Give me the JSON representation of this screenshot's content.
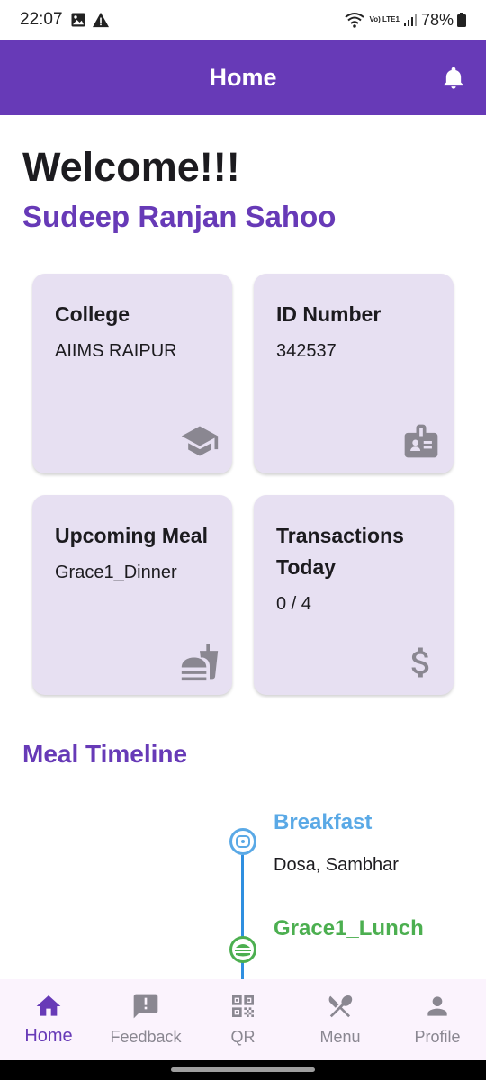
{
  "status_bar": {
    "time": "22:07",
    "network": "Vo) LTE1",
    "battery": "78%"
  },
  "app_bar": {
    "title": "Home"
  },
  "welcome": {
    "heading": "Welcome!!!",
    "name": "Sudeep Ranjan Sahoo"
  },
  "cards": [
    {
      "title": "College",
      "value": "AIIMS RAIPUR",
      "icon": "school-icon"
    },
    {
      "title": "ID Number",
      "value": "342537",
      "icon": "badge-icon"
    },
    {
      "title": "Upcoming Meal",
      "value": "Grace1_Dinner",
      "icon": "fastfood-icon"
    },
    {
      "title": "Transactions Today",
      "value": "0 / 4",
      "icon": "dollar-icon"
    }
  ],
  "timeline": {
    "title": "Meal Timeline",
    "items": [
      {
        "label": "Breakfast",
        "description": "Dosa, Sambhar",
        "color": "#5aa9e6"
      },
      {
        "label": "Grace1_Lunch",
        "description": "",
        "color": "#4caf50"
      }
    ]
  },
  "bottom_nav": [
    {
      "label": "Home",
      "icon": "home-icon",
      "active": true
    },
    {
      "label": "Feedback",
      "icon": "feedback-icon",
      "active": false
    },
    {
      "label": "QR",
      "icon": "qr-icon",
      "active": false
    },
    {
      "label": "Menu",
      "icon": "restaurant-icon",
      "active": false
    },
    {
      "label": "Profile",
      "icon": "person-icon",
      "active": false
    }
  ],
  "colors": {
    "primary": "#673ab7",
    "card_bg": "#e7e0f2",
    "icon_grey": "#8a8791"
  }
}
